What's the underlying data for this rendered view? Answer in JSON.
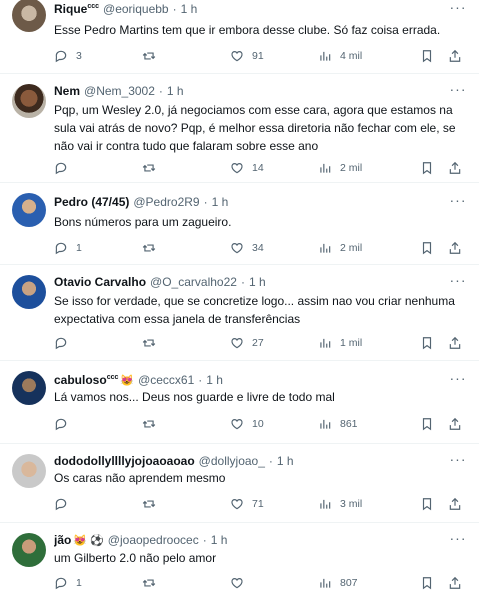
{
  "tweets": [
    {
      "name": "Rique",
      "name_sup": "ccc",
      "handle": "@eoriquebb",
      "dot": "·",
      "time": "1 h",
      "text": "Esse Pedro Martins tem que ir embora desse clube. Só faz coisa errada.",
      "replies": "3",
      "retweets": "",
      "likes": "91",
      "views": "4 mil"
    },
    {
      "name": "Nem",
      "handle": "@Nem_3002",
      "dot": "·",
      "time": "1 h",
      "text": "Pqp, um Wesley 2.0, já negociamos com esse cara, agora que estamos na sula vai atrás de novo? Pqp, é melhor essa diretoria não fechar com ele, se não vai ir contra tudo que falaram sobre esse ano",
      "replies": "",
      "retweets": "",
      "likes": "14",
      "views": "2 mil"
    },
    {
      "name": "Pedro (47/45)",
      "handle": "@Pedro2R9",
      "dot": "·",
      "time": "1 h",
      "text": "Bons números para um zagueiro.",
      "replies": "1",
      "retweets": "",
      "likes": "34",
      "views": "2 mil"
    },
    {
      "name": "Otavio Carvalho",
      "handle": "@O_carvalho22",
      "dot": "·",
      "time": "1 h",
      "text": "Se isso for verdade, que se concretize logo... assim nao vou criar nenhuma expectativa com essa janela de transferências",
      "replies": "",
      "retweets": "",
      "likes": "27",
      "views": "1 mil"
    },
    {
      "name": "cabuloso",
      "name_sup": "ccc",
      "name_emoji": "😻",
      "handle": "@ceccx61",
      "dot": "·",
      "time": "1 h",
      "text": "Lá vamos nos... Deus nos guarde e livre de todo mal",
      "replies": "",
      "retweets": "",
      "likes": "10",
      "views": "861"
    },
    {
      "name": "dododollyllllyjojoaoaoao",
      "handle": "@dollyjoao_",
      "dot": "·",
      "time": "1 h",
      "text": "Os caras não aprendem mesmo",
      "replies": "",
      "retweets": "",
      "likes": "71",
      "views": "3 mil"
    },
    {
      "name": "jão",
      "name_emoji": "😻 ⚽",
      "handle": "@joaopedroocec",
      "dot": "·",
      "time": "1 h",
      "text": "um Gilberto 2.0 não pelo amor",
      "replies": "1",
      "retweets": "",
      "likes": "",
      "views": "807"
    }
  ],
  "icons": [
    "more-icon",
    "reply-icon",
    "retweet-icon",
    "like-icon",
    "views-icon",
    "bookmark-icon",
    "share-icon"
  ],
  "colors": {
    "text": "#0f1419",
    "secondary": "#536471",
    "divider": "#eff3f4",
    "background": "#ffffff"
  }
}
